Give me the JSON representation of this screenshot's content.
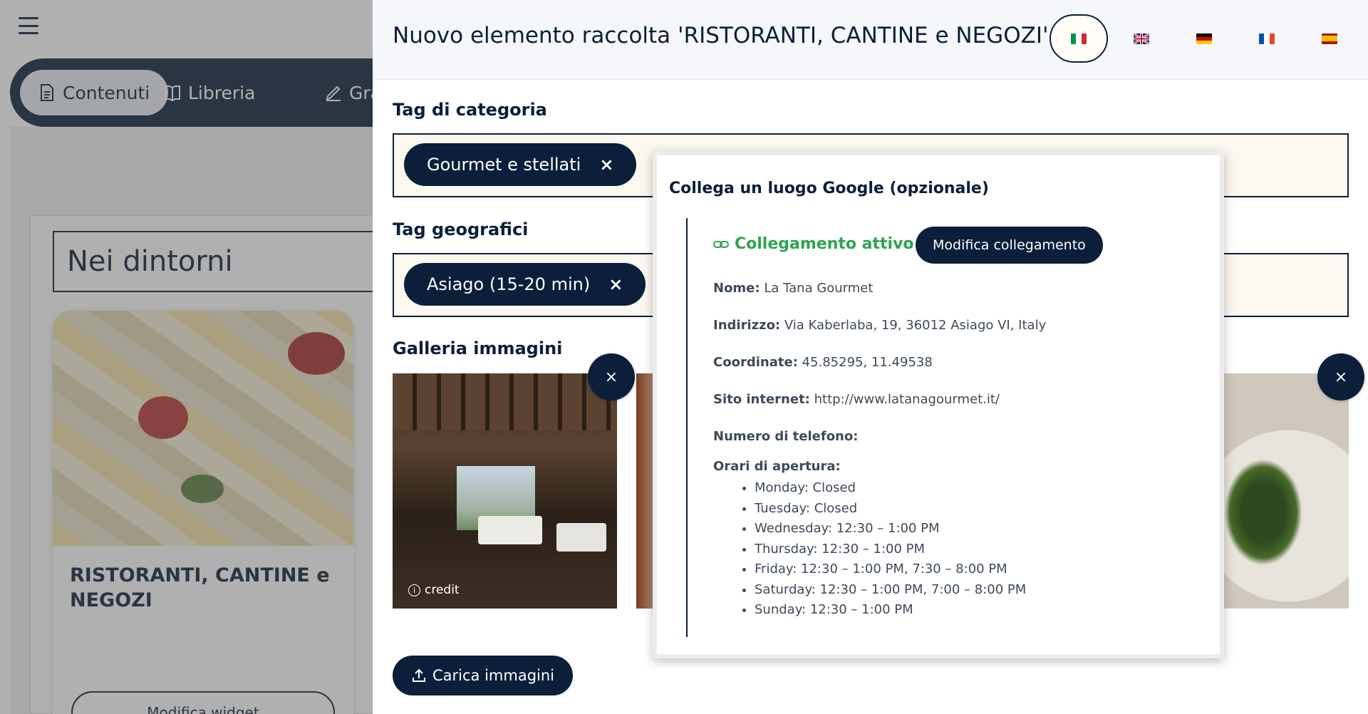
{
  "background": {
    "nav": {
      "contents_label": "Contenuti",
      "library_label": "Libreria",
      "third_label": "Gra"
    },
    "nearby_title": "Nei dintorni",
    "card_title": "RISTORANTI, CANTINE e NEGOZI",
    "edit_widget_label": "Modifica widget"
  },
  "panel": {
    "title": "Nuovo elemento raccolta 'RISTORANTI, CANTINE e NEGOZI'",
    "languages": [
      {
        "code": "it",
        "active": true
      },
      {
        "code": "en",
        "active": false
      },
      {
        "code": "de",
        "active": false
      },
      {
        "code": "fr",
        "active": false
      },
      {
        "code": "es",
        "active": false
      }
    ],
    "category_tags_label": "Tag di categoria",
    "category_tag": "Gourmet e stellati",
    "geo_tags_label": "Tag geografici",
    "geo_tag": "Asiago (15-20 min)",
    "gallery_label": "Galleria immagini",
    "credit_label": "credit",
    "upload_label": "Carica immagini",
    "remove_symbol": "×"
  },
  "popup": {
    "title": "Collega un luogo Google (opzionale)",
    "status": "Collegamento attivo",
    "modify_label": "Modifica collegamento",
    "name_label": "Nome:",
    "name_value": "La Tana Gourmet",
    "address_label": "Indirizzo:",
    "address_value": "Via Kaberlaba, 19, 36012 Asiago VI, Italy",
    "coords_label": "Coordinate:",
    "coords_value": "45.85295, 11.49538",
    "website_label": "Sito internet:",
    "website_value": "http://www.latanagourmet.it/",
    "phone_label": "Numero di telefono:",
    "hours_label": "Orari di apertura:",
    "hours": [
      "Monday: Closed",
      "Tuesday: Closed",
      "Wednesday: 12:30 – 1:00 PM",
      "Thursday: 12:30 – 1:00 PM",
      "Friday: 12:30 – 1:00 PM, 7:30 – 8:00 PM",
      "Saturday: 12:30 – 1:00 PM, 7:00 – 8:00 PM",
      "Sunday: 12:30 – 1:00 PM"
    ]
  },
  "colors": {
    "primary": "#0b1f3a",
    "success": "#2ea44f",
    "tag_box_bg": "#fbf8ef"
  }
}
